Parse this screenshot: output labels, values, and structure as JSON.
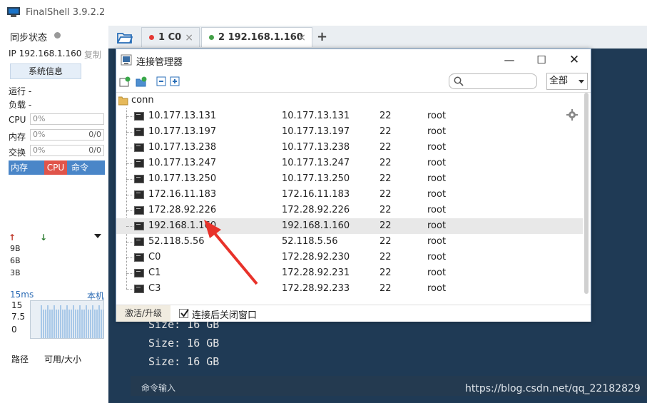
{
  "app": {
    "title": "FinalShell 3.9.2.2"
  },
  "sidebar": {
    "sync_label": "同步状态",
    "ip_label": "IP 192.168.1.160",
    "copy_label": "复制",
    "sysinfo_button": "系统信息",
    "run_label": "运行 -",
    "load_label": "负载 -",
    "cpu_label": "CPU",
    "cpu_value": "0%",
    "mem_label": "内存",
    "mem_value": "0%",
    "mem_ratio": "0/0",
    "swap_label": "交换",
    "swap_value": "0%",
    "swap_ratio": "0/0",
    "tabs": [
      "内存",
      "CPU",
      "命令"
    ],
    "net_labels": [
      "9B",
      "6B",
      "3B"
    ],
    "ping_label": "15ms",
    "host_label": "本机",
    "graph_ticks": [
      "15",
      "7.5",
      "0"
    ],
    "path_label": "路径",
    "avail_label": "可用/大小"
  },
  "tabs": [
    {
      "label": "1 C0",
      "status_color": "#e53935",
      "active": false
    },
    {
      "label": "2 192.168.1.160",
      "status_color": "#43a047",
      "active": true
    }
  ],
  "terminal": {
    "lines": [
      "Size: 16 GB",
      "Size: 16 GB",
      "Size: 16 GB"
    ],
    "cmd_label": "命令输入",
    "watermark": "https://blog.csdn.net/qq_22182829"
  },
  "dialog": {
    "title": "连接管理器",
    "filter_value": "全部",
    "folder_name": "conn",
    "connections": [
      {
        "name": "10.177.13.131",
        "host": "10.177.13.131",
        "port": "22",
        "user": "root"
      },
      {
        "name": "10.177.13.197",
        "host": "10.177.13.197",
        "port": "22",
        "user": "root"
      },
      {
        "name": "10.177.13.238",
        "host": "10.177.13.238",
        "port": "22",
        "user": "root"
      },
      {
        "name": "10.177.13.247",
        "host": "10.177.13.247",
        "port": "22",
        "user": "root"
      },
      {
        "name": "10.177.13.250",
        "host": "10.177.13.250",
        "port": "22",
        "user": "root"
      },
      {
        "name": "172.16.11.183",
        "host": "172.16.11.183",
        "port": "22",
        "user": "root"
      },
      {
        "name": "172.28.92.226",
        "host": "172.28.92.226",
        "port": "22",
        "user": "root"
      },
      {
        "name": "192.168.1.160",
        "host": "192.168.1.160",
        "port": "22",
        "user": "root"
      },
      {
        "name": "52.118.5.56",
        "host": "52.118.5.56",
        "port": "22",
        "user": "root"
      },
      {
        "name": "C0",
        "host": "172.28.92.230",
        "port": "22",
        "user": "root"
      },
      {
        "name": "C1",
        "host": "172.28.92.231",
        "port": "22",
        "user": "root"
      },
      {
        "name": "C3",
        "host": "172.28.92.233",
        "port": "22",
        "user": "root"
      }
    ],
    "activate_label": "激活/升级",
    "close_after_connect_label": "连接后关闭窗口",
    "close_after_connect_checked": true
  }
}
